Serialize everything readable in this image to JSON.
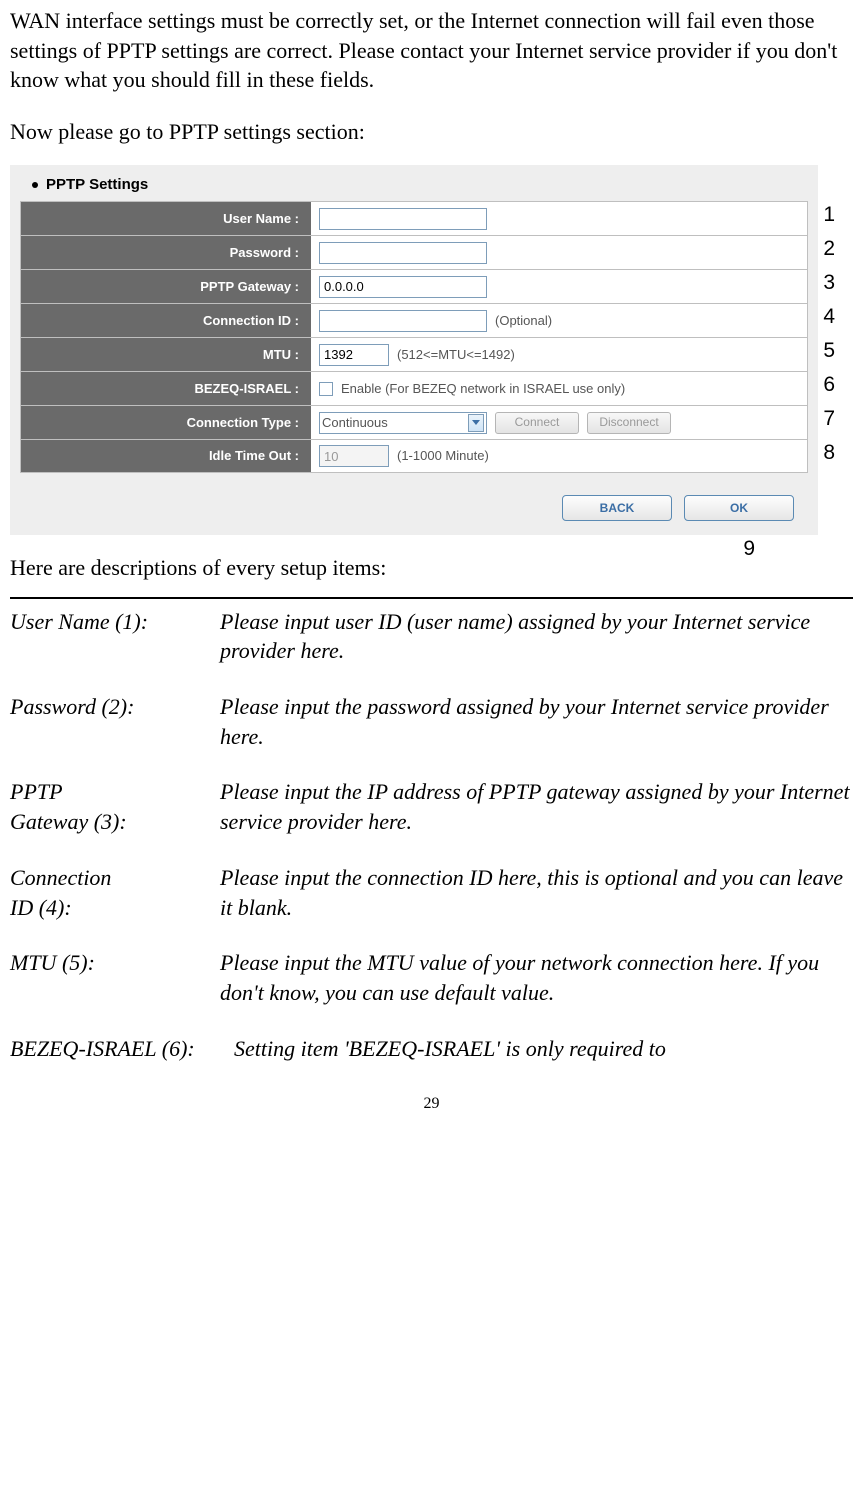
{
  "intro": "WAN interface settings must be correctly set, or the Internet connection will fail even those settings of PPTP settings are correct. Please contact your Internet service provider if you don't know what you should fill in these fields.",
  "lead": "Now please go to PPTP settings section:",
  "figure": {
    "title": "PPTP Settings",
    "rows": {
      "username_label": "User Name :",
      "username_value": "",
      "password_label": "Password :",
      "password_value": "",
      "gateway_label": "PPTP Gateway :",
      "gateway_value": "0.0.0.0",
      "connid_label": "Connection ID :",
      "connid_value": "",
      "connid_hint": "(Optional)",
      "mtu_label": "MTU :",
      "mtu_value": "1392",
      "mtu_hint": "(512<=MTU<=1492)",
      "bezeq_label": "BEZEQ-ISRAEL :",
      "bezeq_hint": "Enable (For BEZEQ network in ISRAEL use only)",
      "conntype_label": "Connection Type :",
      "conntype_value": "Continuous",
      "connect_btn": "Connect",
      "disconnect_btn": "Disconnect",
      "idle_label": "Idle Time Out :",
      "idle_value": "10",
      "idle_hint": "(1-1000 Minute)"
    },
    "buttons": {
      "back": "BACK",
      "ok": "OK"
    },
    "overlays": {
      "n1": "1",
      "n2": "2",
      "n3": "3",
      "n4": "4",
      "n5": "5",
      "n6": "6",
      "n7": "7",
      "n8": "8",
      "n9": "9"
    }
  },
  "desc_lead": "Here are descriptions of every setup items:",
  "definitions": [
    {
      "term": "User Name (1):",
      "desc": "Please input user ID (user name) assigned by your Internet service provider here."
    },
    {
      "term": "Password (2):",
      "desc": "Please input the password assigned by your Internet service provider here."
    },
    {
      "term": "PPTP Gateway (3):",
      "desc": "Please input the IP address of PPTP gateway assigned by your Internet service provider here."
    },
    {
      "term": "Connection ID (4):",
      "desc": "Please input the connection ID here, this is optional and you can leave it blank."
    },
    {
      "term": "MTU (5):",
      "desc": "Please input the MTU value of your network connection here. If you don't know, you can use default value."
    },
    {
      "term": "BEZEQ-ISRAEL (6):",
      "desc": "Setting item 'BEZEQ-ISRAEL' is only required to"
    }
  ],
  "definitions_split": {
    "pptp_line1": "PPTP",
    "pptp_line2": "Gateway (3):",
    "conn_line1": "Connection",
    "conn_line2": "ID (4):"
  },
  "page_number": "29"
}
